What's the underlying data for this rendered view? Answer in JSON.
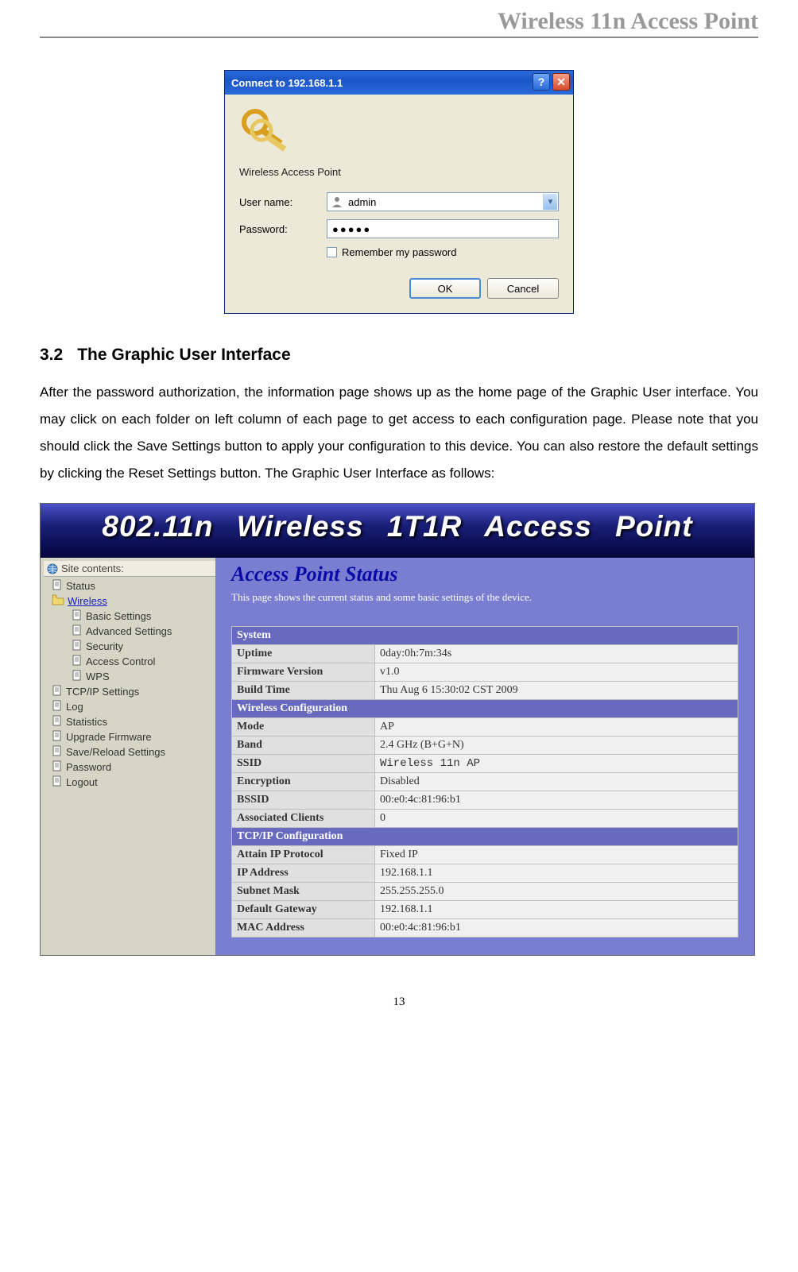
{
  "header_title": "Wireless 11n Access Point",
  "login": {
    "title": "Connect to 192.168.1.1",
    "server": "Wireless Access Point",
    "user_label": "User name:",
    "user_value": "admin",
    "pass_label": "Password:",
    "pass_value": "●●●●●",
    "remember": "Remember my password",
    "ok": "OK",
    "cancel": "Cancel"
  },
  "section": {
    "num": "3.2",
    "title": "The Graphic User Interface",
    "body": "After the password authorization, the information page shows up as the home page of the Graphic User interface. You may click on each folder on left column of each page to get access to each configuration page. Please note that you should click the Save Settings button to apply your configuration to this device. You can also restore the default settings by clicking the Reset Settings button. The Graphic User Interface as follows:"
  },
  "banner": "802.11n Wireless 1T1R Access Point",
  "sidebar": {
    "title": "Site contents:",
    "items": [
      {
        "label": "Status",
        "type": "doc",
        "sub": false
      },
      {
        "label": "Wireless",
        "type": "folder",
        "sub": false,
        "open": true
      },
      {
        "label": "Basic Settings",
        "type": "doc",
        "sub": true
      },
      {
        "label": "Advanced Settings",
        "type": "doc",
        "sub": true
      },
      {
        "label": "Security",
        "type": "doc",
        "sub": true
      },
      {
        "label": "Access Control",
        "type": "doc",
        "sub": true
      },
      {
        "label": "WPS",
        "type": "doc",
        "sub": true
      },
      {
        "label": "TCP/IP Settings",
        "type": "doc",
        "sub": false
      },
      {
        "label": "Log",
        "type": "doc",
        "sub": false
      },
      {
        "label": "Statistics",
        "type": "doc",
        "sub": false
      },
      {
        "label": "Upgrade Firmware",
        "type": "doc",
        "sub": false
      },
      {
        "label": "Save/Reload Settings",
        "type": "doc",
        "sub": false
      },
      {
        "label": "Password",
        "type": "doc",
        "sub": false
      },
      {
        "label": "Logout",
        "type": "doc",
        "sub": false
      }
    ]
  },
  "content": {
    "heading": "Access Point Status",
    "sub": "This page shows the current status and some basic settings of the device.",
    "sections": [
      {
        "cat": "System",
        "rows": [
          {
            "k": "Uptime",
            "v": "0day:0h:7m:34s"
          },
          {
            "k": "Firmware Version",
            "v": "v1.0"
          },
          {
            "k": "Build Time",
            "v": "Thu Aug 6 15:30:02 CST 2009"
          }
        ]
      },
      {
        "cat": "Wireless Configuration",
        "rows": [
          {
            "k": "Mode",
            "v": "AP"
          },
          {
            "k": "Band",
            "v": "2.4 GHz (B+G+N)"
          },
          {
            "k": "SSID",
            "v": "Wireless 11n AP",
            "mono": true
          },
          {
            "k": "Encryption",
            "v": "Disabled"
          },
          {
            "k": "BSSID",
            "v": "00:e0:4c:81:96:b1"
          },
          {
            "k": "Associated Clients",
            "v": "0"
          }
        ]
      },
      {
        "cat": "TCP/IP Configuration",
        "rows": [
          {
            "k": "Attain IP Protocol",
            "v": "Fixed IP"
          },
          {
            "k": "IP Address",
            "v": "192.168.1.1"
          },
          {
            "k": "Subnet Mask",
            "v": "255.255.255.0"
          },
          {
            "k": "Default Gateway",
            "v": "192.168.1.1"
          },
          {
            "k": "MAC Address",
            "v": "00:e0:4c:81:96:b1"
          }
        ]
      }
    ]
  },
  "page_number": "13"
}
